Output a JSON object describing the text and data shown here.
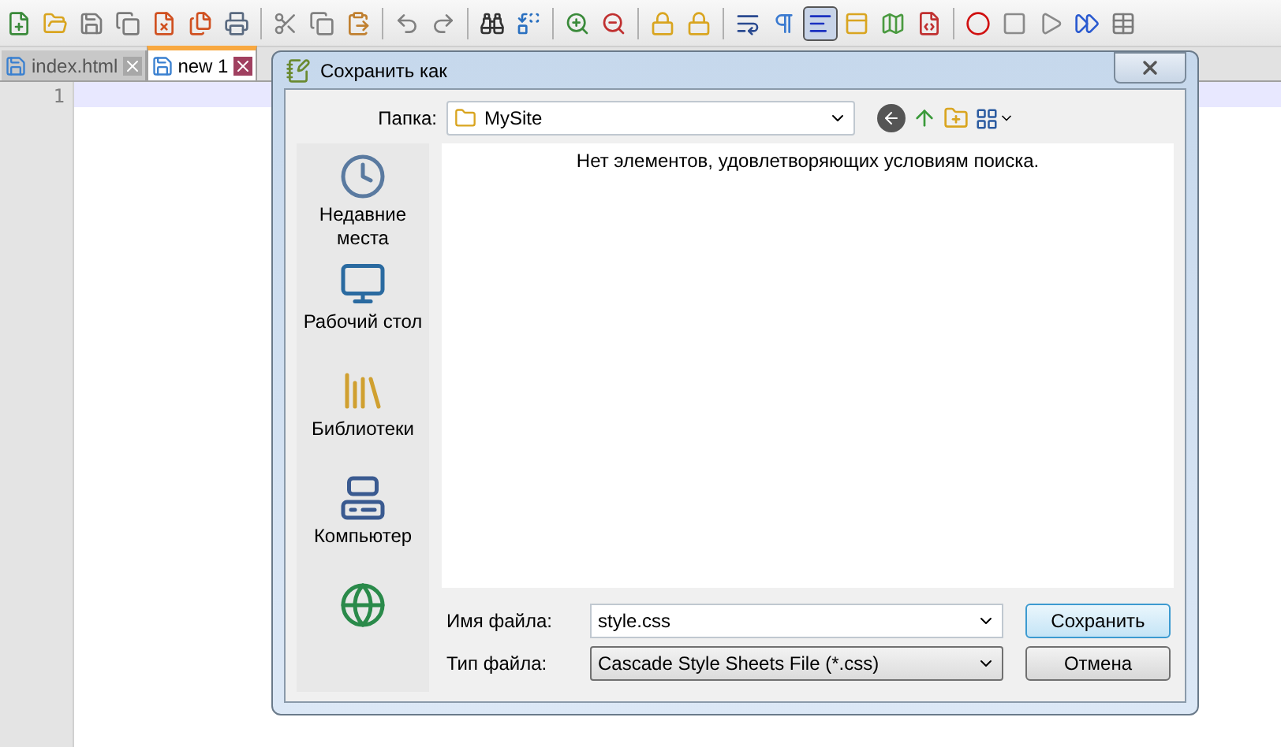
{
  "toolbar": {
    "buttons": [
      {
        "selected": false
      },
      {
        "selected": false
      },
      {
        "selected": false
      },
      {
        "selected": false
      },
      {
        "selected": false
      },
      {
        "selected": false
      },
      {
        "selected": false
      },
      {
        "selected": false
      },
      {
        "selected": false
      },
      {
        "selected": false
      },
      {
        "selected": false
      },
      {
        "selected": false
      },
      {
        "selected": false
      },
      {
        "selected": false
      },
      {
        "selected": false
      },
      {
        "selected": false
      },
      {
        "selected": false
      },
      {
        "selected": false
      },
      {
        "selected": false
      },
      {
        "selected": false
      },
      {
        "selected": true
      },
      {
        "selected": false
      },
      {
        "selected": false
      },
      {
        "selected": false
      },
      {
        "selected": false
      },
      {
        "selected": false
      },
      {
        "selected": false
      },
      {
        "selected": false
      },
      {
        "selected": false
      }
    ]
  },
  "tabs": [
    {
      "label": "index.html",
      "selected": false
    },
    {
      "label": "new 1",
      "selected": true
    }
  ],
  "editor": {
    "line_numbers": [
      "1"
    ]
  },
  "dialog": {
    "title": "Сохранить как",
    "folder_label": "Папка:",
    "folder": "MySite",
    "empty_message": "Нет элементов, удовлетворяющих условиям поиска.",
    "places": [
      {
        "kind": "recent",
        "label": "Недавние места"
      },
      {
        "kind": "desktop",
        "label": "Рабочий стол"
      },
      {
        "kind": "libraries",
        "label": "Библиотеки"
      },
      {
        "kind": "computer",
        "label": "Компьютер"
      },
      {
        "kind": "network"
      }
    ],
    "filename_label": "Имя файла:",
    "filename": "style.css",
    "filetype_label": "Тип файла:",
    "filetype": "Cascade Style Sheets File (*.css)",
    "buttons": [
      "Сохранить",
      "Отмена"
    ]
  }
}
